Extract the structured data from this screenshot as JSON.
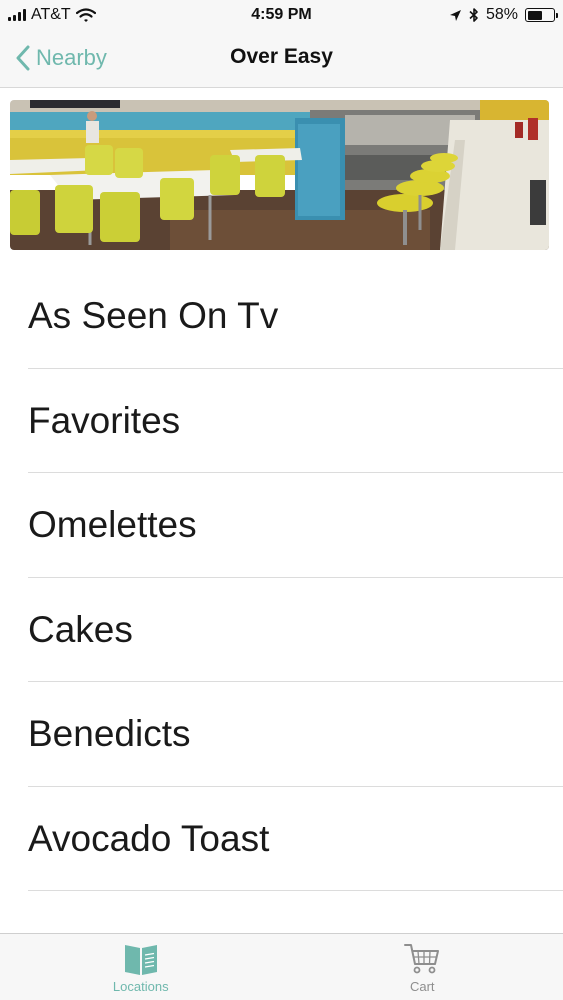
{
  "status_bar": {
    "carrier": "AT&T",
    "time": "4:59 PM",
    "battery": "58%",
    "battery_level": 0.58,
    "icons": [
      "signal-icon",
      "wifi-icon",
      "location-arrow-icon",
      "bluetooth-icon",
      "battery-icon"
    ]
  },
  "nav": {
    "back_label": "Nearby",
    "title": "Over Easy"
  },
  "menu": {
    "items": [
      {
        "label": "As Seen On Tv"
      },
      {
        "label": "Favorites"
      },
      {
        "label": "Omelettes"
      },
      {
        "label": "Cakes"
      },
      {
        "label": "Benedicts"
      },
      {
        "label": "Avocado Toast"
      }
    ]
  },
  "tabs": [
    {
      "label": "Locations",
      "icon": "book-icon",
      "active": true
    },
    {
      "label": "Cart",
      "icon": "cart-icon",
      "active": false
    }
  ],
  "colors": {
    "accent": "#6fb8ad",
    "inactive": "#8e8e8e",
    "bar_background": "#f7f7f7"
  }
}
